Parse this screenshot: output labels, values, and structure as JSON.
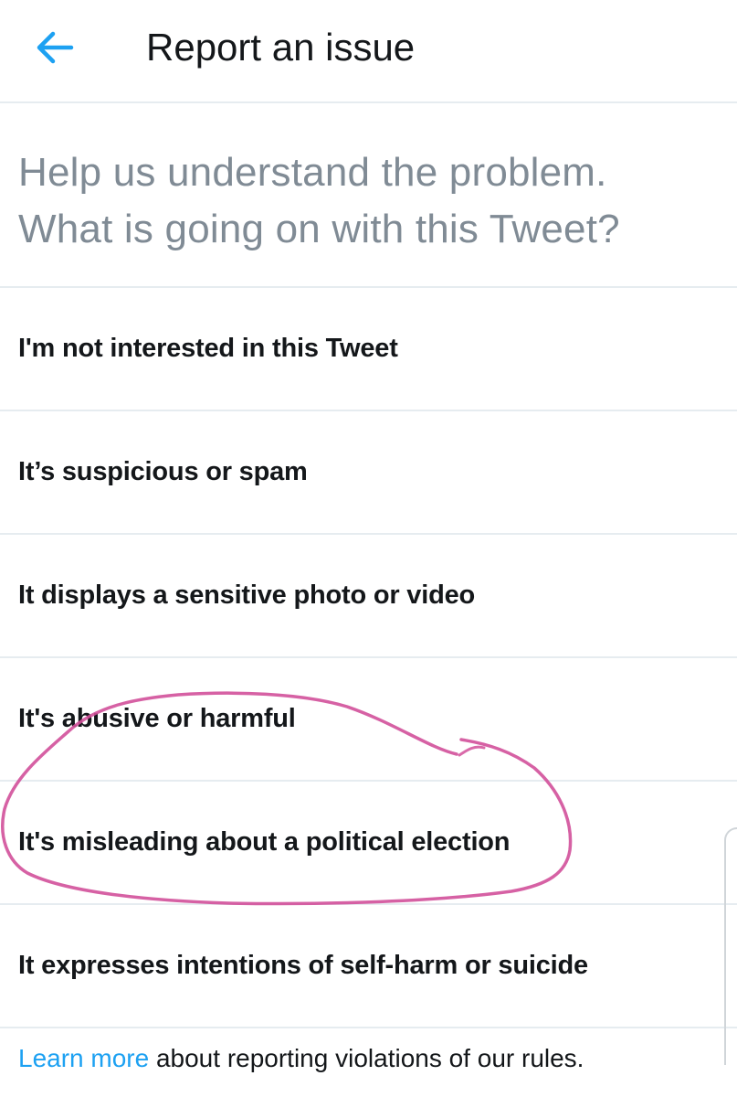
{
  "header": {
    "back_icon": "arrow-left-icon",
    "title": "Report an issue"
  },
  "prompt": {
    "line1": "Help us understand the problem.",
    "line2": "What is going on with this Tweet?"
  },
  "options": [
    {
      "label": "I'm not interested in this Tweet"
    },
    {
      "label": "It’s suspicious or spam"
    },
    {
      "label": "It displays a sensitive photo or video"
    },
    {
      "label": "It's abusive or harmful"
    },
    {
      "label": "It's misleading about a political election"
    },
    {
      "label": "It expresses intentions of self-harm or suicide"
    }
  ],
  "footer": {
    "link": "Learn more",
    "text": " about reporting violations of our rules."
  },
  "colors": {
    "accent": "#1da1f2",
    "text": "#14171a",
    "muted": "#808b95",
    "divider": "#e6ecf0",
    "annotation": "#d2509a"
  }
}
